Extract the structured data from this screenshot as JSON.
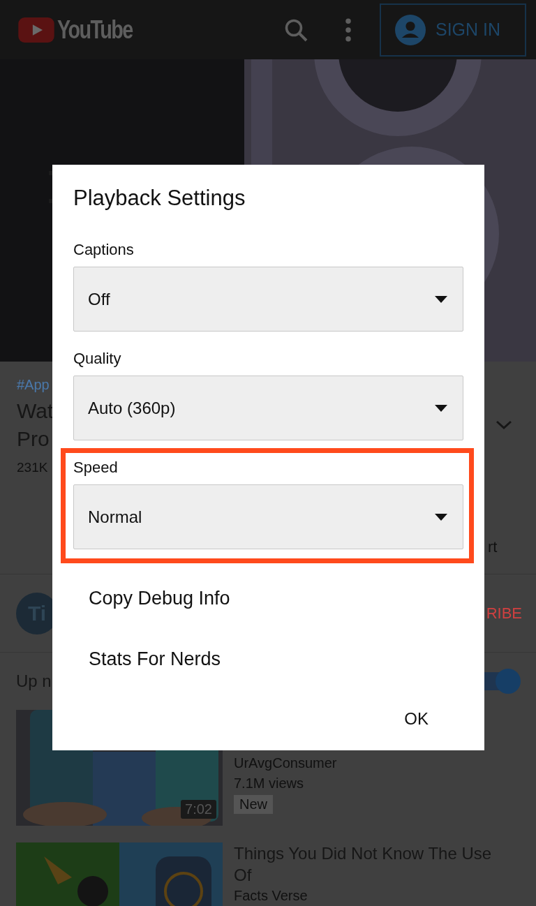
{
  "header": {
    "logo": "YouTube",
    "sign_in": "SIGN IN"
  },
  "video_info": {
    "hashtag": "#App",
    "title_lines": [
      "Wat",
      "Pro"
    ],
    "views": "231K",
    "partial_text": "rt"
  },
  "channel": {
    "avatar": "Ti",
    "subscribe": "RIBE"
  },
  "up_next": {
    "label": "Up n",
    "autoplay_on": true
  },
  "videos": [
    {
      "channel": "UrAvgConsumer",
      "views": "7.1M views",
      "badge": "New",
      "duration": "7:02"
    },
    {
      "title": "Things You Did Not Know The Use Of",
      "channel": "Facts Verse"
    }
  ],
  "dialog": {
    "title": "Playback Settings",
    "settings": [
      {
        "label": "Captions",
        "value": "Off",
        "highlighted": false
      },
      {
        "label": "Quality",
        "value": "Auto (360p)",
        "highlighted": false
      },
      {
        "label": "Speed",
        "value": "Normal",
        "highlighted": true
      }
    ],
    "menu_items": [
      "Copy Debug Info",
      "Stats For Nerds"
    ],
    "ok": "OK"
  }
}
